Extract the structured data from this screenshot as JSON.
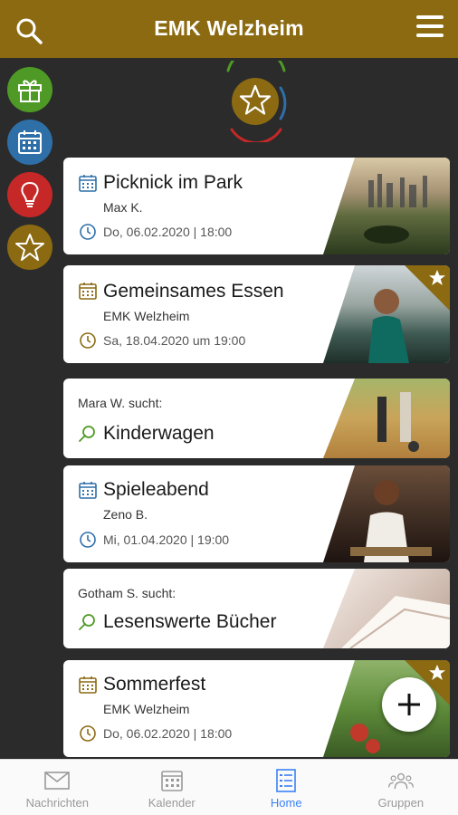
{
  "app": {
    "title": "EMK Welzheim"
  },
  "colors": {
    "brand": "#8b6a12",
    "green": "#4f9a26",
    "blue": "#2f6fa8",
    "red": "#c62828",
    "active_nav": "#3b82f6"
  },
  "side_buttons": [
    {
      "icon": "gift-icon"
    },
    {
      "icon": "calendar-icon"
    },
    {
      "icon": "lightbulb-icon"
    },
    {
      "icon": "star-icon"
    }
  ],
  "cards": [
    {
      "type": "event",
      "title": "Picknick im Park",
      "host": "Max K.",
      "date": "Do, 06.02.2020 | 18:00",
      "accent": "blue",
      "featured": false
    },
    {
      "type": "event",
      "title": "Gemeinsames Essen",
      "host": "EMK Welzheim",
      "date": "Sa, 18.04.2020 um 19:00",
      "accent": "brown",
      "featured": true
    },
    {
      "type": "search",
      "label": "Mara W. sucht:",
      "title": "Kinderwagen"
    },
    {
      "type": "event",
      "title": "Spieleabend",
      "host": "Zeno B.",
      "date": "Mi, 01.04.2020 | 19:00",
      "accent": "blue",
      "featured": false
    },
    {
      "type": "search",
      "label": "Gotham S. sucht:",
      "title": "Lesenswerte Bücher"
    },
    {
      "type": "event",
      "title": "Sommerfest",
      "host": "EMK Welzheim",
      "date": "Do, 06.02.2020 | 18:00",
      "accent": "brown",
      "featured": true
    }
  ],
  "nav": {
    "items": [
      {
        "label": "Nachrichten",
        "icon": "envelope-icon",
        "active": false
      },
      {
        "label": "Kalender",
        "icon": "calendar-icon",
        "active": false
      },
      {
        "label": "Home",
        "icon": "list-icon",
        "active": true
      },
      {
        "label": "Gruppen",
        "icon": "group-icon",
        "active": false
      }
    ]
  }
}
